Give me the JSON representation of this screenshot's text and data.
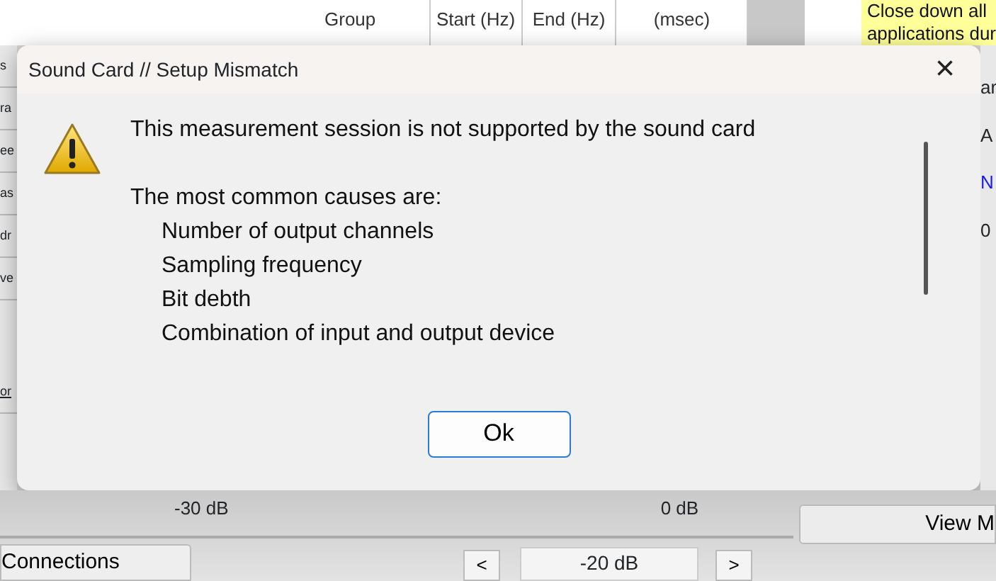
{
  "background": {
    "table_columns": [
      "Group",
      "Start (Hz)",
      "End (Hz)",
      "(msec)"
    ],
    "note_lines": [
      "Close down all",
      "applications dur"
    ],
    "left_fragments": [
      "s",
      "ra",
      "ee",
      "as",
      "dr",
      "ve",
      "or"
    ],
    "right_fragments": [
      {
        "text": "ar",
        "kind": "plain"
      },
      {
        "text": "A",
        "kind": "plain"
      },
      {
        "text": "N",
        "kind": "link"
      },
      {
        "text": "0",
        "kind": "plain"
      }
    ],
    "scale_labels": [
      "-30 dB",
      "0 dB"
    ],
    "view_button": "View M",
    "connections_button": "Connections",
    "step_down": "<",
    "level_field": "-20 dB",
    "step_up": ">"
  },
  "dialog": {
    "title": "Sound Card // Setup Mismatch",
    "close": "×",
    "message": "This measurement session is not supported by the sound card",
    "intro": "The most common causes are:",
    "causes": [
      "Number of output channels",
      "Sampling frequency",
      "Bit debth",
      "Combination of input and output device"
    ],
    "button": "Ok"
  }
}
